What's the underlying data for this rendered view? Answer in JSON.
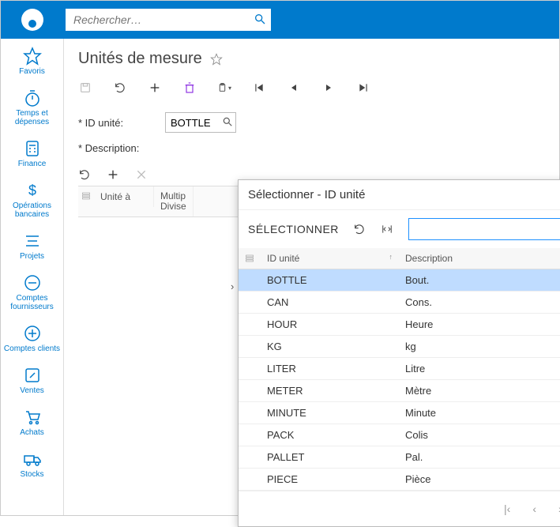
{
  "header": {
    "search_placeholder": "Rechercher…"
  },
  "sidebar": {
    "items": [
      {
        "label": "Favoris"
      },
      {
        "label": "Temps et dépenses"
      },
      {
        "label": "Finance"
      },
      {
        "label": "Opérations bancaires"
      },
      {
        "label": "Projets"
      },
      {
        "label": "Comptes fournisseurs"
      },
      {
        "label": "Comptes clients"
      },
      {
        "label": "Ventes"
      },
      {
        "label": "Achats"
      },
      {
        "label": "Stocks"
      }
    ]
  },
  "page": {
    "title": "Unités de mesure",
    "form": {
      "id_label": "ID unité:",
      "id_value": "BOTTLE",
      "desc_label": "Description:"
    },
    "grid": {
      "col1": "Unité à",
      "col2": "Multip Divise"
    }
  },
  "popup": {
    "title": "Sélectionner - ID unité",
    "select_label": "SÉLECTIONNER",
    "search_value": "",
    "columns": {
      "id": "ID unité",
      "desc": "Description"
    },
    "rows": [
      {
        "id": "BOTTLE",
        "desc": "Bout.",
        "selected": true
      },
      {
        "id": "CAN",
        "desc": "Cons."
      },
      {
        "id": "HOUR",
        "desc": "Heure"
      },
      {
        "id": "KG",
        "desc": "kg"
      },
      {
        "id": "LITER",
        "desc": "Litre"
      },
      {
        "id": "METER",
        "desc": "Mètre"
      },
      {
        "id": "MINUTE",
        "desc": "Minute"
      },
      {
        "id": "PACK",
        "desc": "Colis"
      },
      {
        "id": "PALLET",
        "desc": "Pal."
      },
      {
        "id": "PIECE",
        "desc": "Pièce"
      }
    ]
  }
}
